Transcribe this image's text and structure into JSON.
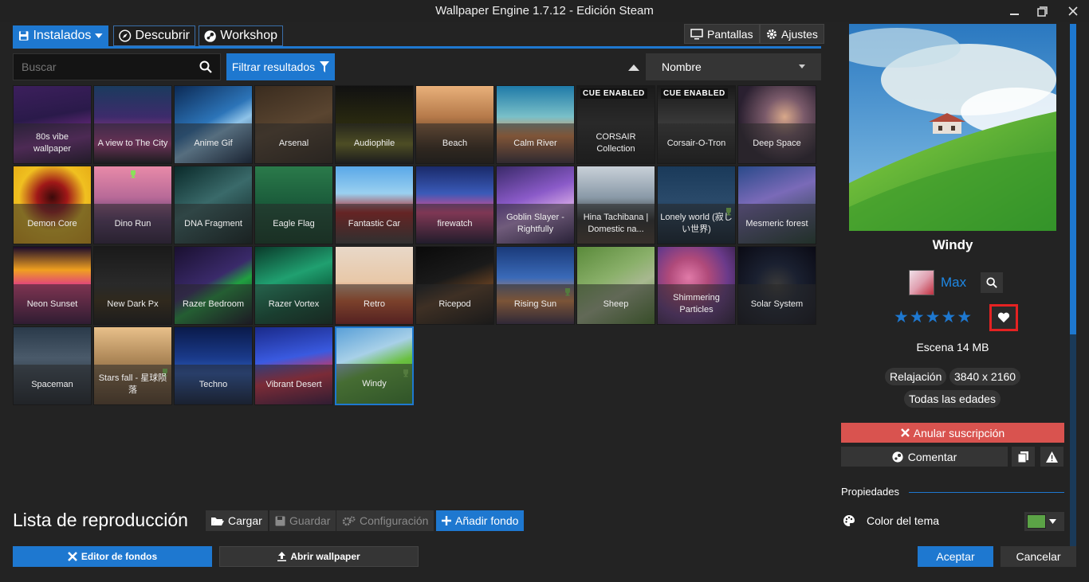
{
  "window": {
    "title": "Wallpaper Engine 1.7.12 - Edición Steam"
  },
  "tabs": [
    {
      "label": "Instalados"
    },
    {
      "label": "Descubrir"
    },
    {
      "label": "Workshop"
    }
  ],
  "top_buttons": {
    "displays": "Pantallas",
    "settings": "Ajustes"
  },
  "search": {
    "placeholder": "Buscar",
    "filter_label": "Filtrar resultados",
    "sort_value": "Nombre"
  },
  "wallpapers": [
    {
      "name": "80s vibe wallpaper",
      "bg": "linear-gradient(170deg,#3c1f5c 0%,#2a1a4a 40%,#7a2d8a 70%,#1b0d2b 100%)"
    },
    {
      "name": "A view to The City",
      "bg": "linear-gradient(180deg,#1b3b5e 0%,#3d2b6b 40%,#b43d8a 75%,#101018 100%)"
    },
    {
      "name": "Anime Gif",
      "bg": "linear-gradient(150deg,#0c2a55 0%,#2c74b8 45%,#8fc3e8 60%,#0a1e3e 100%)"
    },
    {
      "name": "Arsenal",
      "bg": "linear-gradient(160deg,#3a2c1f 0%,#5a4530 50%,#2b2118 100%)"
    },
    {
      "name": "Audiophile",
      "bg": "linear-gradient(180deg,#111 0%,#2a2a10 50%,#7a7a20 75%,#111 100%)"
    },
    {
      "name": "Beach",
      "bg": "linear-gradient(180deg,#e8b07a 0%,#b67a4a 40%,#3a2818 80%,#1a140e 100%)"
    },
    {
      "name": "Calm River",
      "bg": "linear-gradient(180deg,#1f7aa8 0%,#7ac0c8 40%,#e88a4a 65%,#3a2c3a 100%)"
    },
    {
      "name": "CORSAIR Collection",
      "bg": "linear-gradient(180deg,#1a1a1a 0%,#2a2a2a 50%,#111 100%)",
      "badge": "CUE ENABLED"
    },
    {
      "name": "Corsair-O-Tron",
      "bg": "linear-gradient(180deg,#1a1a1a 0%,#3a3a3a 50%,#151515 100%)",
      "badge": "CUE ENABLED"
    },
    {
      "name": "Deep Space",
      "bg": "radial-gradient(circle at 60% 40%,#d8a88a 0%,#7a5a6a 30%,#2a2030 70%)"
    },
    {
      "name": "Demon Core",
      "bg": "radial-gradient(circle at 50% 40%,#3a0a0a 0%,#a01818 25%,#f0c020 55%,#e0a010 100%)"
    },
    {
      "name": "Dino Run",
      "bg": "linear-gradient(180deg,#e88aa8 0%,#b86a98 40%,#5a3a6a 70%,#2a1a3a 100%)",
      "trophy": true
    },
    {
      "name": "DNA Fragment",
      "bg": "linear-gradient(150deg,#0a2a2a 0%,#3a6a6a 45%,#0a1a1a 100%)"
    },
    {
      "name": "Eagle Flag",
      "bg": "linear-gradient(180deg,#2a7a4a 0%,#1a5a3a 50%,#0a3a20 100%)"
    },
    {
      "name": "Fantastic Car",
      "bg": "linear-gradient(180deg,#5aa8e8 0%,#9ad0f0 35%,#b02020 60%,#3a3a3a 100%)"
    },
    {
      "name": "firewatch",
      "bg": "linear-gradient(180deg,#1a2a6a 0%,#3a5ab8 35%,#e84a8a 60%,#1a1030 100%)"
    },
    {
      "name": "Goblin Slayer - Rightfully",
      "bg": "linear-gradient(160deg,#3a2a6a 0%,#8a5ac8 40%,#c89ae0 60%,#2a1a4a 100%)"
    },
    {
      "name": "Hina Tachibana | Domestic na...",
      "bg": "linear-gradient(180deg,#c8d0d8 0%,#8a9aa8 40%,#2a2a2a 70%,#4a3a30 100%)"
    },
    {
      "name": "Lonely world (寂しい世界)",
      "bg": "linear-gradient(180deg,#1a3a5a 0%,#2a4a6a 45%,#0a1a2a 100%)",
      "trophy": true
    },
    {
      "name": "Mesmeric forest",
      "bg": "linear-gradient(160deg,#2a4a8a 0%,#7a6ab8 40%,#1a3a2a 100%)"
    },
    {
      "name": "Neon Sunset",
      "bg": "linear-gradient(180deg,#1a0a2a 0%,#f0a020 30%,#e04080 50%,#3a1040 100%)"
    },
    {
      "name": "New Dark Px",
      "bg": "linear-gradient(180deg,#1a1a1a 0%,#2a2a2a 50%,#3a2a10 70%,#111 100%)"
    },
    {
      "name": "Razer Bedroom",
      "bg": "linear-gradient(150deg,#1a1030 0%,#3a2a6a 45%,#20a040 60%,#100a20 100%)"
    },
    {
      "name": "Razer Vortex",
      "bg": "linear-gradient(160deg,#0a3a2a 0%,#20a070 40%,#0a5a3a 70%,#06281a 100%)"
    },
    {
      "name": "Retro",
      "bg": "linear-gradient(180deg,#e8d8c8 0%,#e8c8a8 45%,#e06030 70%,#8a1a1a 100%)"
    },
    {
      "name": "Ricepod",
      "bg": "linear-gradient(160deg,#0a0a0a 0%,#1a1a1a 40%,#5a3a20 60%,#0a0a0a 100%)"
    },
    {
      "name": "Rising Sun",
      "bg": "linear-gradient(180deg,#1a3a7a 0%,#3a6ab8 40%,#e08a4a 70%,#3a2a4a 100%)",
      "trophy": true
    },
    {
      "name": "Sheep",
      "bg": "linear-gradient(150deg,#5a8a3a 0%,#8ab06a 40%,#a8b890 60%,#4a7a2a 100%)"
    },
    {
      "name": "Shimmering Particles",
      "bg": "radial-gradient(circle at 40% 40%,#e07aa8 0%,#b04a7a 30%,#6a3a8a 60%,#2a1a3a 100%)"
    },
    {
      "name": "Solar System",
      "bg": "radial-gradient(circle at 50% 50%,#3a3a3a 0%,#1a2030 40%,#0a0a14 100%)"
    },
    {
      "name": "Spaceman",
      "bg": "linear-gradient(180deg,#2a3a4a 0%,#4a5a6a 40%,#1a2028 100%)"
    },
    {
      "name": "Stars fall - 星球陨落",
      "bg": "linear-gradient(180deg,#e8c08a 0%,#b08a5a 40%,#5a4028 100%)",
      "trophy": true
    },
    {
      "name": "Techno",
      "bg": "linear-gradient(180deg,#0a1a4a 0%,#1a3a8a 40%,#2a5ab8 60%,#0a1a3a 100%)"
    },
    {
      "name": "Vibrant Desert",
      "bg": "linear-gradient(170deg,#1a2a8a 0%,#3a5ae0 40%,#e0304a 65%,#3a1040 100%)"
    },
    {
      "name": "Windy",
      "bg": "linear-gradient(160deg,#5aa0d8 0%,#a8d0e8 35%,#6ac040 55%,#3a8a2a 100%)",
      "trophy": true,
      "selected": true
    }
  ],
  "playlist": {
    "title": "Lista de reproducción",
    "load": "Cargar",
    "save": "Guardar",
    "config": "Configuración",
    "add": "Añadir fondo"
  },
  "bottom": {
    "editor": "Editor de fondos",
    "open": "Abrir wallpaper"
  },
  "detail": {
    "title": "Windy",
    "author": "Max",
    "stars": "★★★★★",
    "info": "Escena 14 MB",
    "tags": [
      "Relajación",
      "3840 x 2160"
    ],
    "age": "Todas las edades",
    "unsubscribe": "Anular suscripción",
    "comment": "Comentar",
    "properties": "Propiedades",
    "color_label": "Color del tema",
    "color_value": "#5ba346"
  },
  "actions": {
    "accept": "Aceptar",
    "cancel": "Cancelar"
  }
}
